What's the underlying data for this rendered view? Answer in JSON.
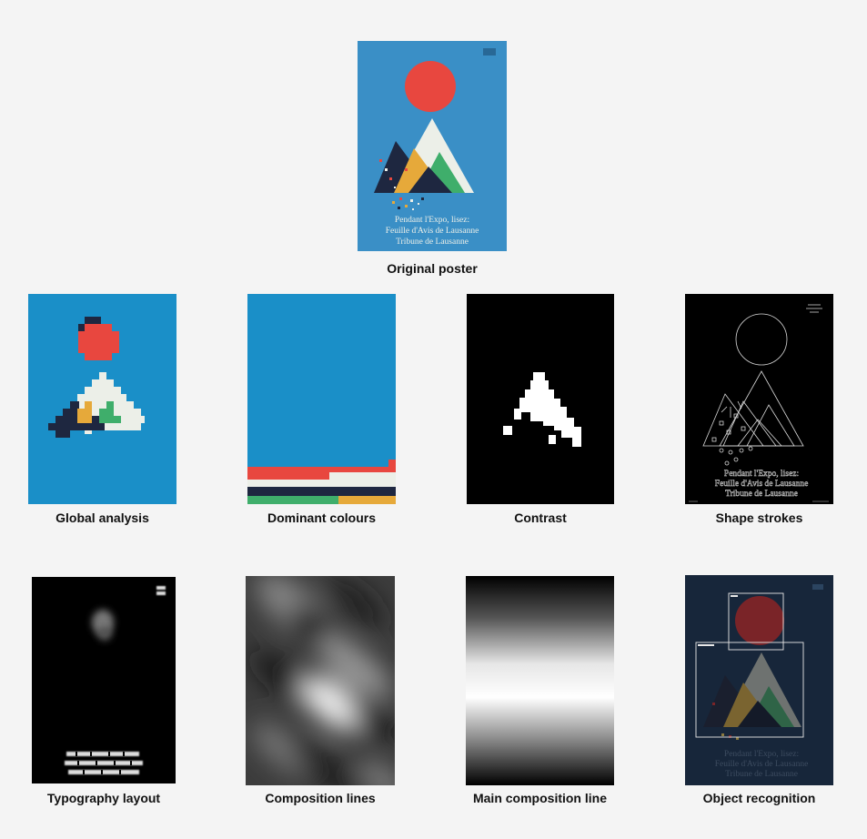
{
  "poster": {
    "line1": "Pendant l'Expo, lisez:",
    "line2": "Feuille d'Avis de Lausanne",
    "line3": "Tribune de Lausanne"
  },
  "captions": {
    "original": "Original poster",
    "global": "Global analysis",
    "dominant": "Dominant colours",
    "contrast": "Contrast",
    "strokes": "Shape strokes",
    "typography": "Typography layout",
    "composition": "Composition lines",
    "main_line": "Main composition line",
    "objects": "Object recognition"
  },
  "colors": {
    "background": "#f4f4f4",
    "poster_blue": "#3a8fc6",
    "analysis_blue": "#1a8fc8",
    "sun_red": "#e8473f",
    "mountain_white": "#ecefe8",
    "green": "#3fae6b",
    "navy": "#1e2740",
    "mustard": "#e6a93a",
    "dark_overlay": "#17263a"
  }
}
